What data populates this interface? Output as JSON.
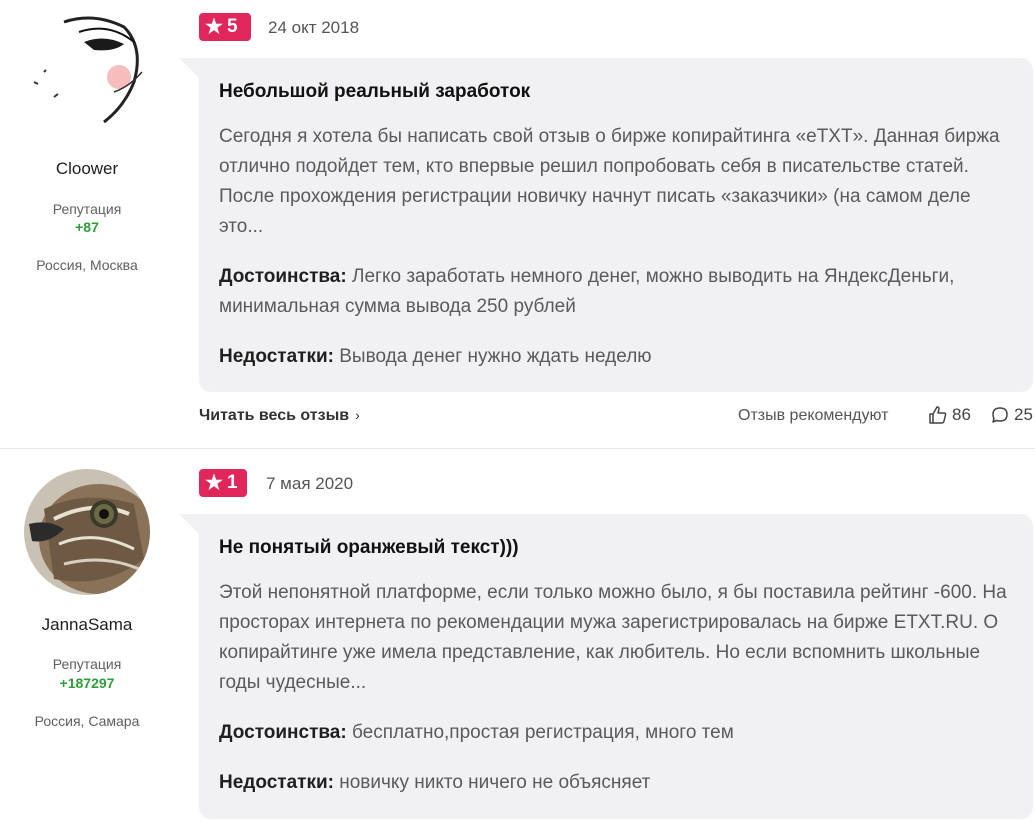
{
  "reviews": [
    {
      "author": {
        "name": "Cloower",
        "rep_label": "Репутация",
        "rep_value": "+87",
        "location": "Россия, Москва"
      },
      "rating": "5",
      "date": "24 окт 2018",
      "title": "Небольшой реальный заработок",
      "text": "Сегодня я хотела бы написать свой отзыв о бирже копирайтинга «eTXT». Данная биржа отлично подойдет тем, кто впервые решил попробовать себя в писательстве статей. После прохождения регистрации новичку начнут писать «заказчики» (на самом деле это...",
      "pros_label": "Достоинства:",
      "pros": "Легко заработать немного денег, можно выводить на ЯндексДеньги, минимальная сумма вывода 250 рублей",
      "cons_label": "Недостатки:",
      "cons": "Вывода денег нужно ждать неделю",
      "read_more": "Читать весь отзыв",
      "recommend_label": "Отзыв рекомендуют",
      "likes": "86",
      "comments": "25"
    },
    {
      "author": {
        "name": "JannaSama",
        "rep_label": "Репутация",
        "rep_value": "+187297",
        "location": "Россия, Самара"
      },
      "rating": "1",
      "date": "7 мая 2020",
      "title": "Не понятый оранжевый текст)))",
      "text": "Этой непонятной платформе, если только можно было, я бы поставила рейтинг -600. На просторах интернета по рекомендации мужа зарегистрировалась на бирже ETXT.RU. О копирайтинге уже имела представление, как любитель. Но если вспомнить школьные годы чудесные...",
      "pros_label": "Достоинства:",
      "pros": "бесплатно,простая регистрация, много тем",
      "cons_label": "Недостатки:",
      "cons": "новичку никто ничего не объясняет"
    }
  ],
  "colors": {
    "rating_badge": "#e0265a",
    "reputation": "#2e9e38",
    "bubble": "#f1f1f3"
  },
  "icons": {
    "rating": "star-icon",
    "read_more": "chevron-right-icon",
    "likes": "thumbs-up-icon",
    "comments": "comment-icon"
  }
}
